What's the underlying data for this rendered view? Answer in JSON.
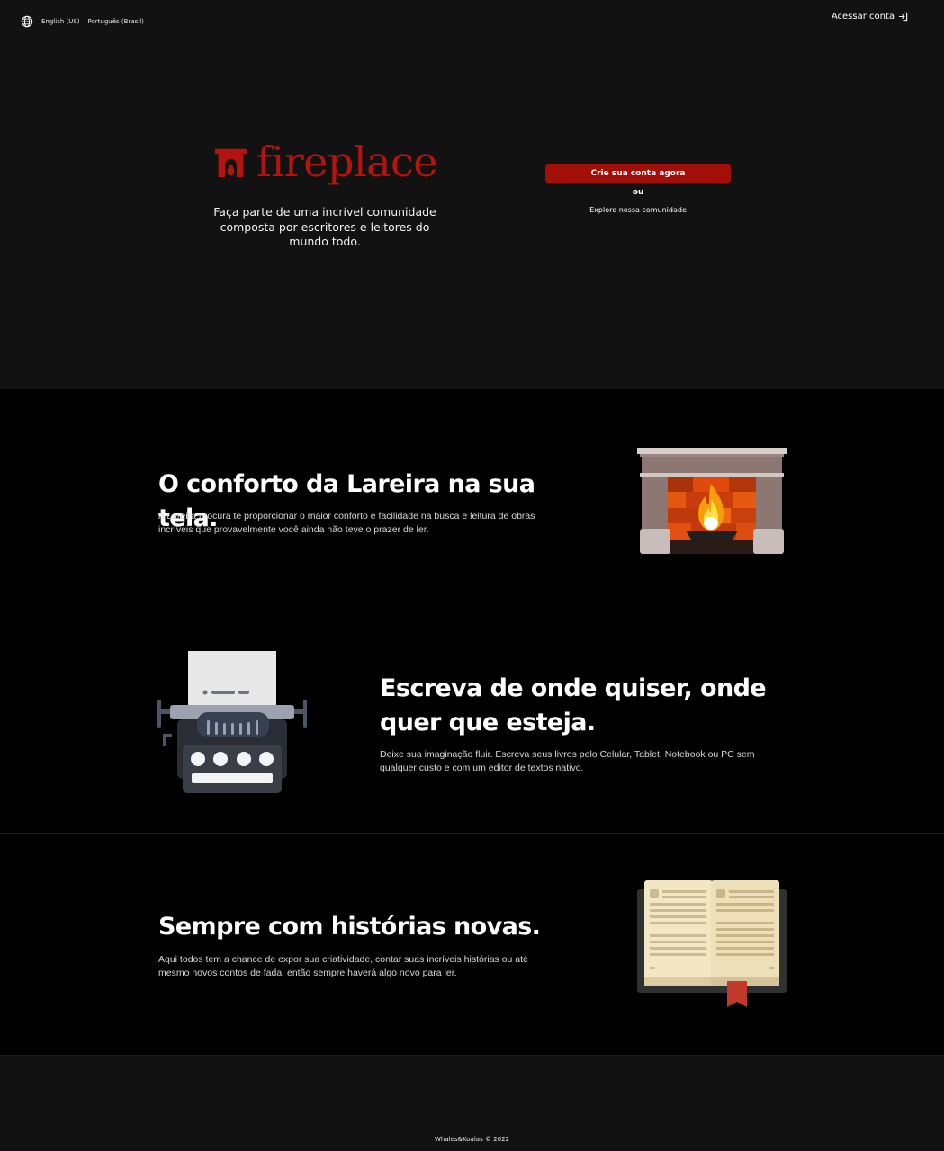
{
  "languages": {
    "english": "English (US)",
    "portuguese": "Português (Brasil)"
  },
  "header": {
    "login_label": "Acessar conta"
  },
  "hero": {
    "logo_text": "fireplace",
    "tagline": "Faça parte de uma incrível comunidade composta por escritores e leitores do mundo todo.",
    "cta_label": "Crie sua conta agora",
    "or_label": "ou",
    "explore_label": "Explore nossa comunidade"
  },
  "features": [
    {
      "title": "O conforto da Lareira na sua tela.",
      "description": "A Lareira procura te proporcionar o maior conforto e facilidade na busca e leitura de obras incríveis que provavelmente você ainda não teve o prazer de ler.",
      "icon": "fireplace-illustration"
    },
    {
      "title": "Escreva de onde quiser, onde quer que esteja.",
      "description": "Deixe sua imaginação fluir. Escreva seus livros pelo Celular, Tablet, Notebook ou PC sem qualquer custo e com um editor de textos nativo.",
      "icon": "typewriter-illustration"
    },
    {
      "title": "Sempre com histórias novas.",
      "description": "Aqui todos tem a chance de expor sua criatividade, contar suas incríveis histórias ou até mesmo novos contos de fada, então sempre haverá algo novo para ler.",
      "icon": "open-book-illustration"
    }
  ],
  "footer": {
    "copyright": "Whales&Koalas © 2022"
  },
  "colors": {
    "brand_red": "#b3140f",
    "button_red": "#a10f08",
    "background": "#121212",
    "section_bg": "#000000"
  }
}
